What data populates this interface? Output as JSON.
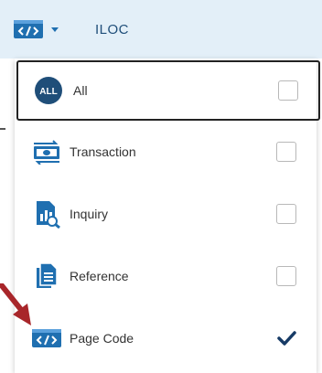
{
  "topbar": {
    "type_button_icon": "code-icon",
    "label": "ILOC"
  },
  "dropdown": {
    "items": [
      {
        "label": "All",
        "icon": "all-badge-icon",
        "badge_text": "ALL",
        "checked": false
      },
      {
        "label": "Transaction",
        "icon": "transaction-icon",
        "checked": false
      },
      {
        "label": "Inquiry",
        "icon": "inquiry-icon",
        "checked": false
      },
      {
        "label": "Reference",
        "icon": "reference-icon",
        "checked": false
      },
      {
        "label": "Page Code",
        "icon": "page-code-icon",
        "checked": true
      }
    ]
  },
  "colors": {
    "topbar_bg": "#e3eff8",
    "icon_blue": "#1f6fb0",
    "check_navy": "#173b66",
    "arrow_red": "#a8262a"
  }
}
